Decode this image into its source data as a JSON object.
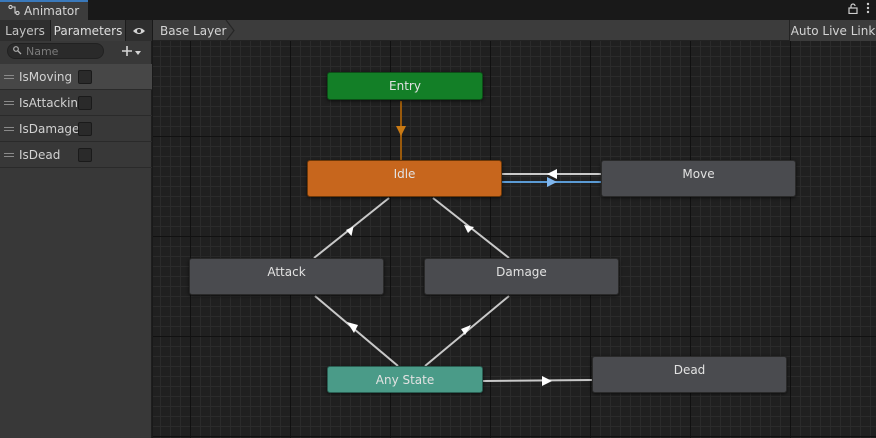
{
  "window": {
    "title": "Animator"
  },
  "left_panel": {
    "tabs": [
      {
        "label": "Layers"
      },
      {
        "label": "Parameters"
      }
    ],
    "search": {
      "placeholder": "Name",
      "value": ""
    },
    "parameters": [
      {
        "name": "IsMoving",
        "checked": false
      },
      {
        "name": "IsAttackin",
        "checked": false
      },
      {
        "name": "IsDamage",
        "checked": false
      },
      {
        "name": "IsDead",
        "checked": false
      }
    ]
  },
  "graph": {
    "breadcrumb": "Base Layer",
    "live_link_label": "Auto Live Link",
    "states": {
      "entry": "Entry",
      "idle": "Idle",
      "move": "Move",
      "attack": "Attack",
      "damage": "Damage",
      "any_state": "Any State",
      "dead": "Dead"
    }
  },
  "colors": {
    "entry": "#137f27",
    "default_state": "#c7661d",
    "any_state": "#4a9b88",
    "state": "#4a4b4f",
    "selected_transition": "#5b9bd5",
    "entry_transition": "#9a5a0c"
  }
}
